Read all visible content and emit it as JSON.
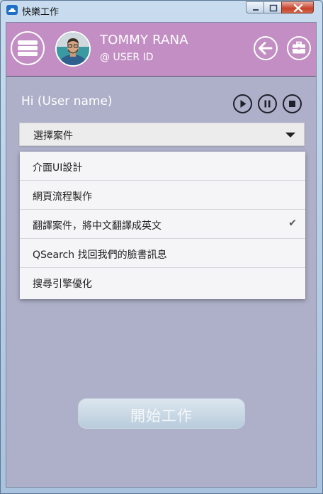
{
  "window": {
    "title": "快樂工作"
  },
  "header": {
    "user_name": "TOMMY RANA",
    "user_id": "@ USER ID"
  },
  "greeting": "Hi (User name)",
  "select": {
    "selected_label": "選擇案件"
  },
  "dropdown": {
    "items": [
      {
        "label": "介面UI設計",
        "checked": false
      },
      {
        "label": "網頁流程製作",
        "checked": false
      },
      {
        "label": "翻譯案件，將中文翻譯成英文",
        "checked": true,
        "check_mark": "✔"
      },
      {
        "label": "QSearch 找回我們的臉書訊息",
        "checked": false
      },
      {
        "label": "搜尋引擎優化",
        "checked": false
      }
    ]
  },
  "start_button": {
    "label": "開始工作"
  },
  "colors": {
    "header_bg": "#c28ec3",
    "client_bg": "#aeb0c9",
    "dropdown_bg": "#f5f5f7"
  }
}
